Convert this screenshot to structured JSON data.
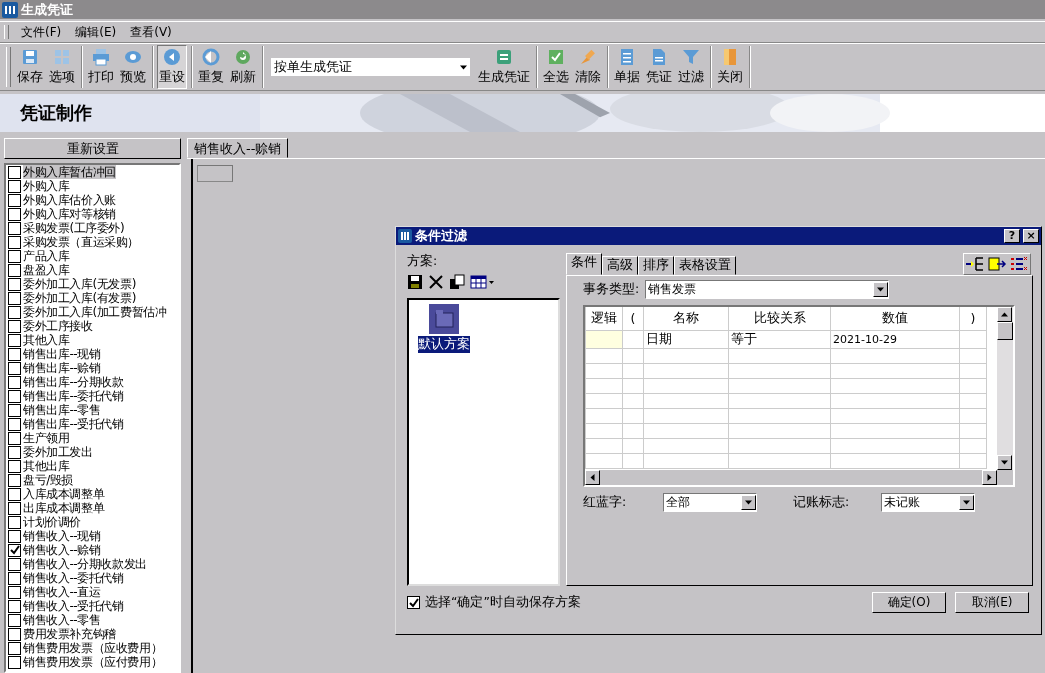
{
  "window": {
    "title": "生成凭证"
  },
  "menu": [
    "文件(F)",
    "编辑(E)",
    "查看(V)"
  ],
  "toolbar": [
    [
      {
        "kind": "button",
        "label": "保存",
        "pressed": false
      },
      {
        "kind": "button",
        "label": "选项",
        "pressed": false
      }
    ],
    [
      {
        "kind": "button",
        "label": "打印",
        "pressed": false
      },
      {
        "kind": "button",
        "label": "预览",
        "pressed": false
      }
    ],
    [
      {
        "kind": "button",
        "label": "重设",
        "pressed": true
      }
    ],
    [
      {
        "kind": "button",
        "label": "重复",
        "pressed": false
      },
      {
        "kind": "button",
        "label": "刷新",
        "pressed": false
      }
    ],
    [
      {
        "kind": "combo",
        "value": "按单生成凭证"
      },
      {
        "kind": "button",
        "label": "生成凭证",
        "pressed": false
      }
    ],
    [
      {
        "kind": "button",
        "label": "全选",
        "pressed": false
      },
      {
        "kind": "button",
        "label": "清除",
        "pressed": false
      }
    ],
    [
      {
        "kind": "button",
        "label": "单据",
        "pressed": false
      },
      {
        "kind": "button",
        "label": "凭证",
        "pressed": false
      },
      {
        "kind": "button",
        "label": "过滤",
        "pressed": false
      }
    ],
    [
      {
        "kind": "button",
        "label": "关闭",
        "pressed": false
      }
    ]
  ],
  "banner": {
    "title": "凭证制作"
  },
  "sidebar": {
    "reset_button": "重新设置",
    "items": [
      {
        "label": "外购入库暂估冲回",
        "checked": false,
        "selected": true
      },
      {
        "label": "外购入库",
        "checked": false,
        "selected": false
      },
      {
        "label": "外购入库估价入账",
        "checked": false,
        "selected": false
      },
      {
        "label": "外购入库对等核销",
        "checked": false,
        "selected": false
      },
      {
        "label": "采购发票(工序委外)",
        "checked": false,
        "selected": false
      },
      {
        "label": "采购发票（直运采购）",
        "checked": false,
        "selected": false
      },
      {
        "label": "产品入库",
        "checked": false,
        "selected": false
      },
      {
        "label": "盘盈入库",
        "checked": false,
        "selected": false
      },
      {
        "label": "委外加工入库(无发票)",
        "checked": false,
        "selected": false
      },
      {
        "label": "委外加工入库(有发票)",
        "checked": false,
        "selected": false
      },
      {
        "label": "委外加工入库(加工费暂估冲",
        "checked": false,
        "selected": false
      },
      {
        "label": "委外工序接收",
        "checked": false,
        "selected": false
      },
      {
        "label": "其他入库",
        "checked": false,
        "selected": false
      },
      {
        "label": "销售出库--现销",
        "checked": false,
        "selected": false
      },
      {
        "label": "销售出库--赊销",
        "checked": false,
        "selected": false
      },
      {
        "label": "销售出库--分期收款",
        "checked": false,
        "selected": false
      },
      {
        "label": "销售出库--委托代销",
        "checked": false,
        "selected": false
      },
      {
        "label": "销售出库--零售",
        "checked": false,
        "selected": false
      },
      {
        "label": "销售出库--受托代销",
        "checked": false,
        "selected": false
      },
      {
        "label": "生产领用",
        "checked": false,
        "selected": false
      },
      {
        "label": "委外加工发出",
        "checked": false,
        "selected": false
      },
      {
        "label": "其他出库",
        "checked": false,
        "selected": false
      },
      {
        "label": "盘亏/毁损",
        "checked": false,
        "selected": false
      },
      {
        "label": "入库成本调整单",
        "checked": false,
        "selected": false
      },
      {
        "label": "出库成本调整单",
        "checked": false,
        "selected": false
      },
      {
        "label": "计划价调价",
        "checked": false,
        "selected": false
      },
      {
        "label": "销售收入--现销",
        "checked": false,
        "selected": false
      },
      {
        "label": "销售收入--赊销",
        "checked": true,
        "selected": false
      },
      {
        "label": "销售收入--分期收款发出",
        "checked": false,
        "selected": false
      },
      {
        "label": "销售收入--委托代销",
        "checked": false,
        "selected": false
      },
      {
        "label": "销售收入--直运",
        "checked": false,
        "selected": false
      },
      {
        "label": "销售收入--受托代销",
        "checked": false,
        "selected": false
      },
      {
        "label": "销售收入--零售",
        "checked": false,
        "selected": false
      },
      {
        "label": "费用发票补充钩稽",
        "checked": false,
        "selected": false
      },
      {
        "label": "销售费用发票（应收费用）",
        "checked": false,
        "selected": false
      },
      {
        "label": "销售费用发票（应付费用）",
        "checked": false,
        "selected": false
      }
    ]
  },
  "document_tabs": [
    {
      "label": "销售收入--赊销",
      "selected": true
    }
  ],
  "dialog": {
    "title": "条件过滤",
    "help_button": "?",
    "close_button": "×",
    "scheme_label": "方案:",
    "schemes": [
      {
        "label": "默认方案",
        "selected": true
      }
    ],
    "tabs": [
      {
        "label": "条件",
        "selected": true
      },
      {
        "label": "高级",
        "selected": false
      },
      {
        "label": "排序",
        "selected": false
      },
      {
        "label": "表格设置",
        "selected": false
      }
    ],
    "type_label": "事务类型:",
    "type_value": "销售发票",
    "grid": {
      "columns": [
        "逻辑",
        "(",
        "名称",
        "比较关系",
        "数值",
        ")"
      ],
      "rows": [
        {
          "name": "日期",
          "relation": "等于",
          "value": "2021-10-29",
          "current": true
        }
      ]
    },
    "red_blue_label": "红蓝字:",
    "red_blue_value": "全部",
    "posting_label": "记账标志:",
    "posting_value": "未记账",
    "autosave": {
      "label": "选择“确定”时自动保存方案",
      "checked": true
    },
    "ok_button": "确定(O)",
    "cancel_button": "取消(E)"
  }
}
